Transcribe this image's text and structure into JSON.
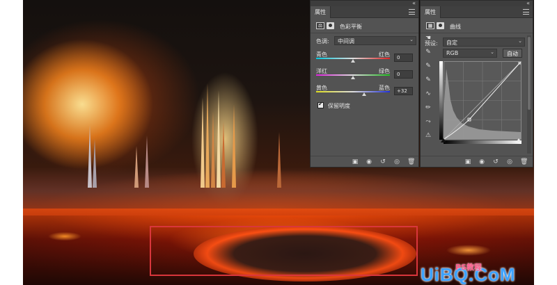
{
  "color_balance_panel": {
    "tab": "属性",
    "title": "色彩平衡",
    "tone_label": "色调:",
    "tone_value": "中间调",
    "sliders": [
      {
        "left": "青色",
        "right": "红色",
        "value": "0",
        "level": 0
      },
      {
        "left": "洋红",
        "right": "绿色",
        "value": "0",
        "level": 0
      },
      {
        "left": "黄色",
        "right": "蓝色",
        "value": "+32",
        "level": 32
      }
    ],
    "preserve_luminosity": "保留明度",
    "preserve_checked": true
  },
  "curves_panel": {
    "tab": "属性",
    "title": "曲线",
    "preset_label": "预设:",
    "preset_value": "自定",
    "channel_value": "RGB",
    "auto_label": "自动"
  },
  "watermark": {
    "text": "UiBQ.CoM",
    "small": "PS教程"
  },
  "colors": {
    "panel_bg": "#535353",
    "tab_bg": "#404040",
    "selection_border": "#d9363c",
    "watermark": "#3ca2ff"
  }
}
